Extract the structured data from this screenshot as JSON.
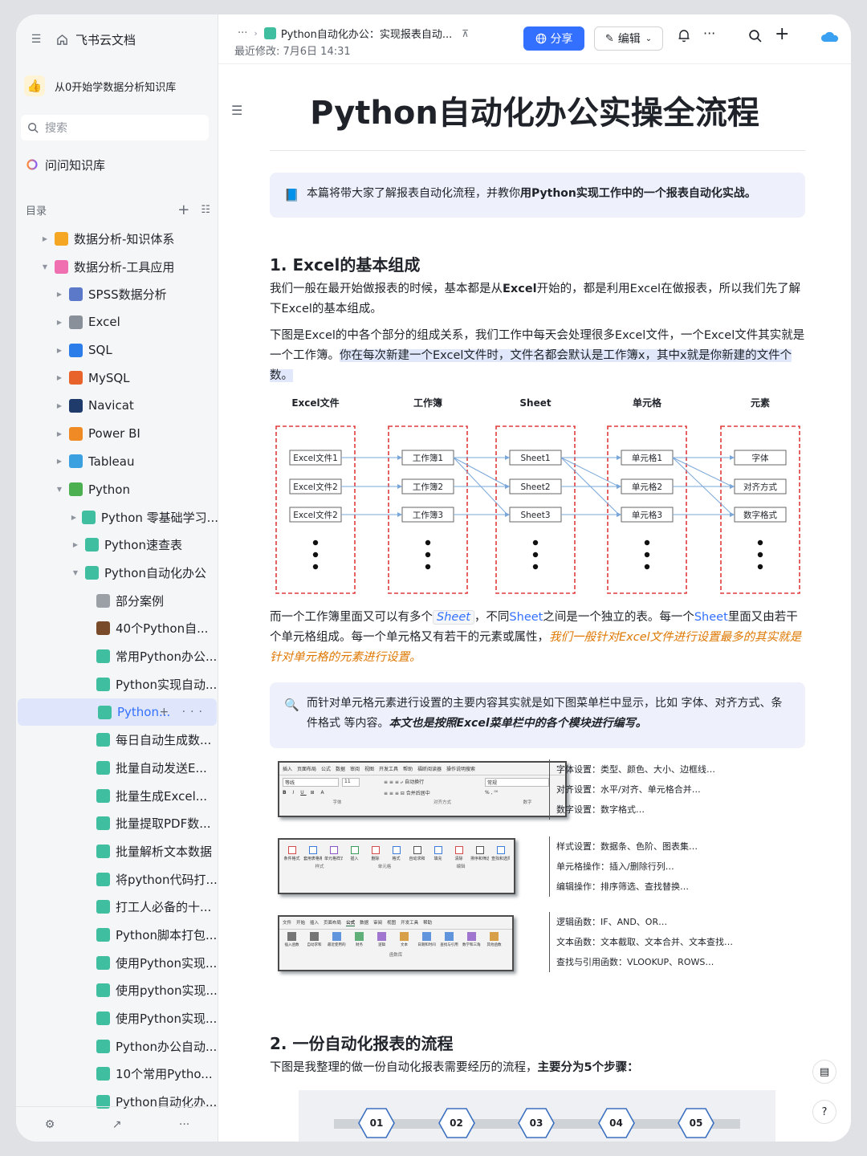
{
  "app": {
    "name": "飞书云文档"
  },
  "knowledge_base": {
    "name": "从0开始学数据分析知识库",
    "logo": "thumbs-up"
  },
  "search": {
    "placeholder": "搜索"
  },
  "ask": {
    "label": "问问知识库"
  },
  "toc": {
    "title": "目录"
  },
  "tree": [
    {
      "label": "数据分析-知识体系",
      "level": 0,
      "arrow": "right",
      "icon": "#f5a623"
    },
    {
      "label": "数据分析-工具应用",
      "level": 0,
      "arrow": "down",
      "icon": "#f06fb0"
    },
    {
      "label": "SPSS数据分析",
      "level": 1,
      "arrow": "right",
      "icon": "#5b79c8"
    },
    {
      "label": "Excel",
      "level": 1,
      "arrow": "right",
      "icon": "#8a9099"
    },
    {
      "label": "SQL",
      "level": 1,
      "arrow": "right",
      "icon": "#2b7de9"
    },
    {
      "label": "MySQL",
      "level": 1,
      "arrow": "right",
      "icon": "#e8632b"
    },
    {
      "label": "Navicat",
      "level": 1,
      "arrow": "right",
      "icon": "#1f3b6b"
    },
    {
      "label": "Power BI",
      "level": 1,
      "arrow": "right",
      "icon": "#f08a24"
    },
    {
      "label": "Tableau",
      "level": 1,
      "arrow": "right",
      "icon": "#3aa0e0"
    },
    {
      "label": "Python",
      "level": 1,
      "arrow": "down",
      "icon": "#4caf50"
    },
    {
      "label": "Python 零基础学习...",
      "level": 2,
      "arrow": "right",
      "icon": "#3fbfa0"
    },
    {
      "label": "Python速查表",
      "level": 2,
      "arrow": "right",
      "icon": "#3fbfa0"
    },
    {
      "label": "Python自动化办公",
      "level": 2,
      "arrow": "down",
      "icon": "#3fbfa0"
    },
    {
      "label": "部分案例",
      "level": 3,
      "arrow": "",
      "icon": "#9aa0a6"
    },
    {
      "label": "40个Python自...",
      "level": 3,
      "arrow": "",
      "icon": "#7a4b2a"
    },
    {
      "label": "常用Python办公...",
      "level": 3,
      "arrow": "",
      "icon": "#3fbfa0"
    },
    {
      "label": "Python实现自动...",
      "level": 3,
      "arrow": "",
      "icon": "#3fbfa0"
    },
    {
      "label": "Python...",
      "level": 3,
      "arrow": "",
      "icon": "#3fbfa0",
      "selected": true
    },
    {
      "label": "每日自动生成数...",
      "level": 3,
      "arrow": "",
      "icon": "#3fbfa0"
    },
    {
      "label": "批量自动发送E...",
      "level": 3,
      "arrow": "",
      "icon": "#3fbfa0"
    },
    {
      "label": "批量生成Excel...",
      "level": 3,
      "arrow": "",
      "icon": "#3fbfa0"
    },
    {
      "label": "批量提取PDF数...",
      "level": 3,
      "arrow": "",
      "icon": "#3fbfa0"
    },
    {
      "label": "批量解析文本数据",
      "level": 3,
      "arrow": "",
      "icon": "#3fbfa0"
    },
    {
      "label": "将python代码打...",
      "level": 3,
      "arrow": "",
      "icon": "#3fbfa0"
    },
    {
      "label": "打工人必备的十...",
      "level": 3,
      "arrow": "",
      "icon": "#3fbfa0"
    },
    {
      "label": "Python脚本打包...",
      "level": 3,
      "arrow": "",
      "icon": "#3fbfa0"
    },
    {
      "label": "使用Python实现...",
      "level": 3,
      "arrow": "",
      "icon": "#3fbfa0"
    },
    {
      "label": "使用python实现...",
      "level": 3,
      "arrow": "",
      "icon": "#3fbfa0"
    },
    {
      "label": "使用Python实现...",
      "level": 3,
      "arrow": "",
      "icon": "#3fbfa0"
    },
    {
      "label": "Python办公自动...",
      "level": 3,
      "arrow": "",
      "icon": "#3fbfa0"
    },
    {
      "label": "10个常用Pytho...",
      "level": 3,
      "arrow": "",
      "icon": "#3fbfa0"
    },
    {
      "label": "Python自动化办...",
      "level": 3,
      "arrow": "",
      "icon": "#3fbfa0"
    }
  ],
  "topbar": {
    "breadcrumb_more": "···",
    "breadcrumb_doc": "Python自动化办公：实现报表自动...",
    "modified": "最近修改: 7月6日 14:31",
    "share": "分享",
    "edit": "编辑"
  },
  "doc": {
    "title": "Python自动化办公实操全流程",
    "callout1_pre": "本篇将带大家了解报表自动化流程，并教你",
    "callout1_bold": "用Python实现工作中的一个报表自动化实战。",
    "h1": "1. Excel的基本组成",
    "p1_a": "我们一般在最开始做报表的时候，基本都是从",
    "p1_b": "Excel",
    "p1_c": "开始的，都是利用Excel在做报表，所以我们先了解下Excel的基本组成。",
    "p2_a": "下图是Excel的中各个部分的组成关系，我们工作中每天会处理很多Excel文件，一个Excel文件其实就是一个工作簿。",
    "p2_b": "你在每次新建一个Excel文件时，文件名都会默认是工作簿x，其中x就是你新建的文件个数。",
    "p3_a": "而一个工作簿里面又可以有多个",
    "p3_code": "Sheet",
    "p3_b": "，不同",
    "p3_c": "Sheet",
    "p3_d": "之间是一个独立的表。每一个",
    "p3_e": "Sheet",
    "p3_f": "里面又由若干个单元格组成。每一个单元格又有若干的元素或属性，",
    "p3_g": "我们一般针对Excel文件进行设置最多的其实就是针对单元格的元素进行设置。",
    "callout2_pre": "而针对单元格元素进行设置的主要内容其实就是如下图菜单栏中显示，比如 字体、对齐方式、条件格式 等内容。",
    "callout2_bold": "本文也是按照Excel菜单栏中的各个模块进行编写。",
    "h2": "2. 一份自动化报表的流程",
    "p4_a": "下图是我整理的做一份自动化报表需要经历的流程，",
    "p4_b": "主要分为5个步骤："
  },
  "diagram": {
    "headers": [
      "Excel文件",
      "工作簿",
      "Sheet",
      "单元格",
      "元素"
    ],
    "col1": [
      "Excel文件1",
      "Excel文件2",
      "Excel文件2"
    ],
    "col2": [
      "工作簿1",
      "工作簿2",
      "工作簿3"
    ],
    "col3": [
      "Sheet1",
      "Sheet2",
      "Sheet3"
    ],
    "col4": [
      "单元格1",
      "单元格2",
      "单元格3"
    ],
    "col5": [
      "字体",
      "对齐方式",
      "数字格式"
    ]
  },
  "menus": [
    {
      "lines": [
        "字体设置：类型、颜色、大小、边框线…",
        "对齐设置：水平/对齐、单元格合并…",
        "数字设置：数字格式…"
      ]
    },
    {
      "lines": [
        "样式设置：数据条、色阶、图表集…",
        "单元格操作：插入/删除行列…",
        "编辑操作：排序筛选、查找替换…"
      ]
    },
    {
      "lines": [
        "逻辑函数：IF、AND、OR…",
        "文本函数：文本截取、文本合并、文本查找…",
        "查找与引用函数：VLOOKUP、ROWS…"
      ]
    }
  ],
  "ribbon1": {
    "tabs": "插入　页面布局　公式　数据　审阅　视图　开发工具　帮助　福昕阅读器　操作说明搜索",
    "font": "等线",
    "size": "11",
    "wrap": "自动换行",
    "merge": "合并后居中",
    "numfmt": "常规",
    "groups": [
      "字体",
      "对齐方式",
      "数字"
    ]
  },
  "ribbon2": {
    "labels": [
      "条件格式",
      "套用表格格式",
      "单元格样式",
      "插入",
      "删除",
      "格式",
      "自动求和",
      "填充",
      "清除",
      "排序和筛选",
      "查找和选择"
    ],
    "groups": [
      "样式",
      "单元格",
      "编辑"
    ]
  },
  "ribbon3": {
    "tabs": [
      "文件",
      "开始",
      "插入",
      "页面布局",
      "公式",
      "数据",
      "审阅",
      "视图",
      "开发工具",
      "帮助"
    ],
    "labels": [
      "插入函数",
      "自动求和",
      "最近使用的函数",
      "财务",
      "逻辑",
      "文本",
      "日期和时间",
      "查找与引用",
      "数学和三角函数",
      "其他函数"
    ],
    "group": "函数库"
  },
  "flow_steps": [
    "01",
    "02",
    "03",
    "04",
    "05"
  ]
}
